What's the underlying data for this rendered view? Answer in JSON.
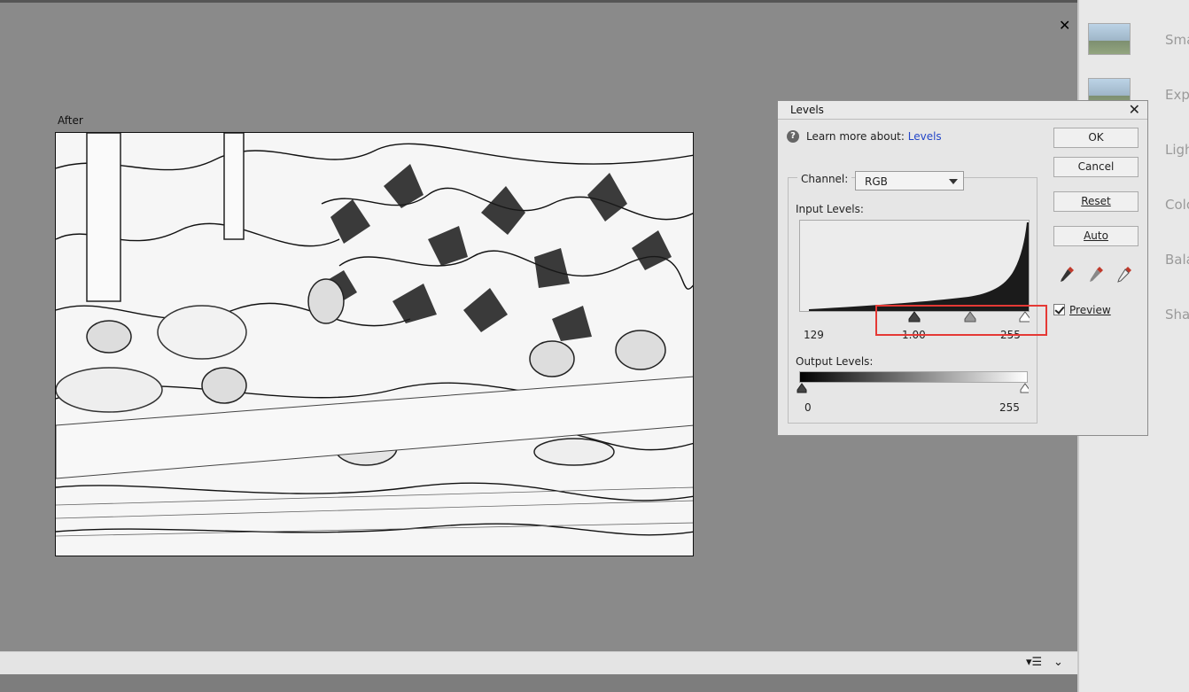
{
  "workspace": {
    "after_label": "After",
    "close_icon": "close-icon"
  },
  "right_panel": {
    "items": [
      {
        "label": "Sma",
        "icon": "photo-thumbnail-icon"
      },
      {
        "label": "Exp",
        "icon": "exposure-thumbnail-icon"
      },
      {
        "label": "Ligh",
        "icon": ""
      },
      {
        "label": "Colo",
        "icon": ""
      },
      {
        "label": "Bala",
        "icon": ""
      },
      {
        "label": "Sha",
        "icon": ""
      }
    ]
  },
  "levels_dialog": {
    "title": "Levels",
    "learn_more_prefix": "Learn more about:",
    "learn_more_link": "Levels",
    "channel_label": "Channel:",
    "channel_value": "RGB",
    "input_levels_label": "Input Levels:",
    "input_black": "129",
    "input_gamma": "1.00",
    "input_white": "255",
    "output_levels_label": "Output Levels:",
    "output_black": "0",
    "output_white": "255",
    "buttons": {
      "ok": "OK",
      "cancel": "Cancel",
      "reset": "Reset",
      "auto": "Auto"
    },
    "preview_label": "Preview",
    "preview_checked": true,
    "eyedroppers": [
      "black-eyedropper-icon",
      "gray-eyedropper-icon",
      "white-eyedropper-icon"
    ]
  },
  "bottombar": {
    "icons": [
      "list-options-icon",
      "chevron-down-icon"
    ]
  },
  "colors": {
    "workspace_bg": "#8a8a8a",
    "dialog_bg": "#e6e6e6",
    "link": "#2346c8",
    "highlight": "#e53935"
  }
}
